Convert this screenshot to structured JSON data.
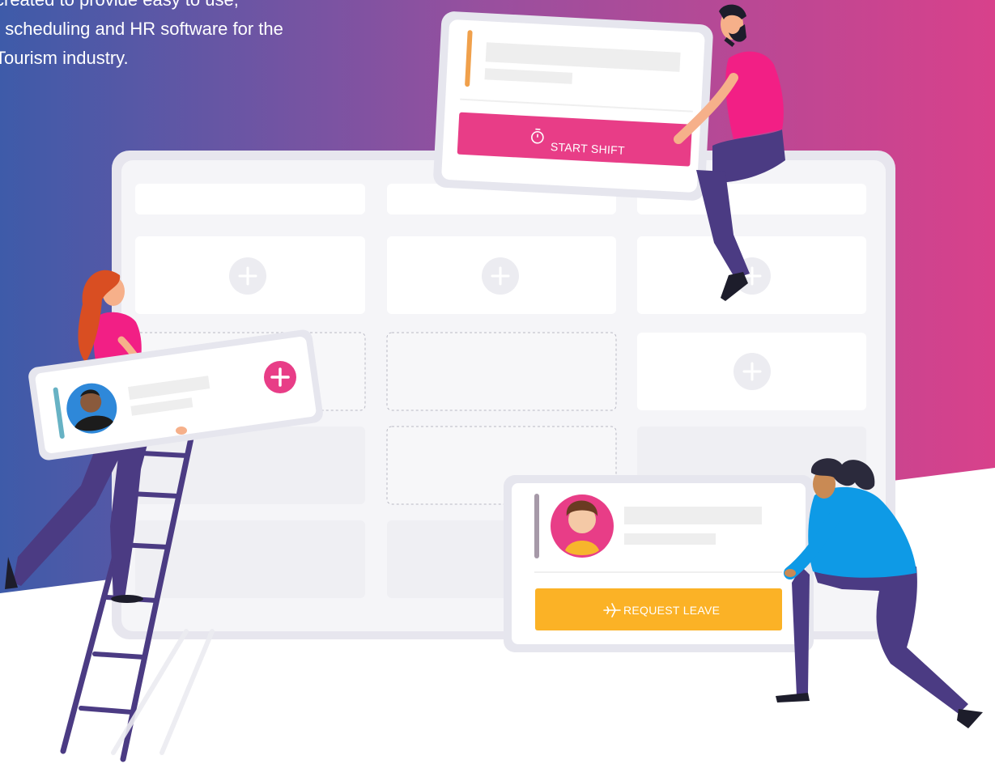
{
  "hero": {
    "tagline_lines": [
      "created to provide easy to use,",
      "t scheduling and HR software for the",
      "Tourism industry."
    ]
  },
  "cards": {
    "start_shift": {
      "button_label": "START SHIFT",
      "icon": "stopwatch-icon"
    },
    "request_leave": {
      "button_label": "REQUEST LEAVE",
      "icon": "airplane-icon"
    },
    "add_shift": {
      "icon": "plus-icon"
    }
  },
  "colors": {
    "gradient_left": "#3e5ba9",
    "gradient_mid": "#9a4f9e",
    "gradient_right": "#d8418b",
    "accent_pink": "#e83d87",
    "accent_yellow": "#fbb226",
    "character_purple": "#4b3b83",
    "character_blue": "#0e9ae6"
  }
}
